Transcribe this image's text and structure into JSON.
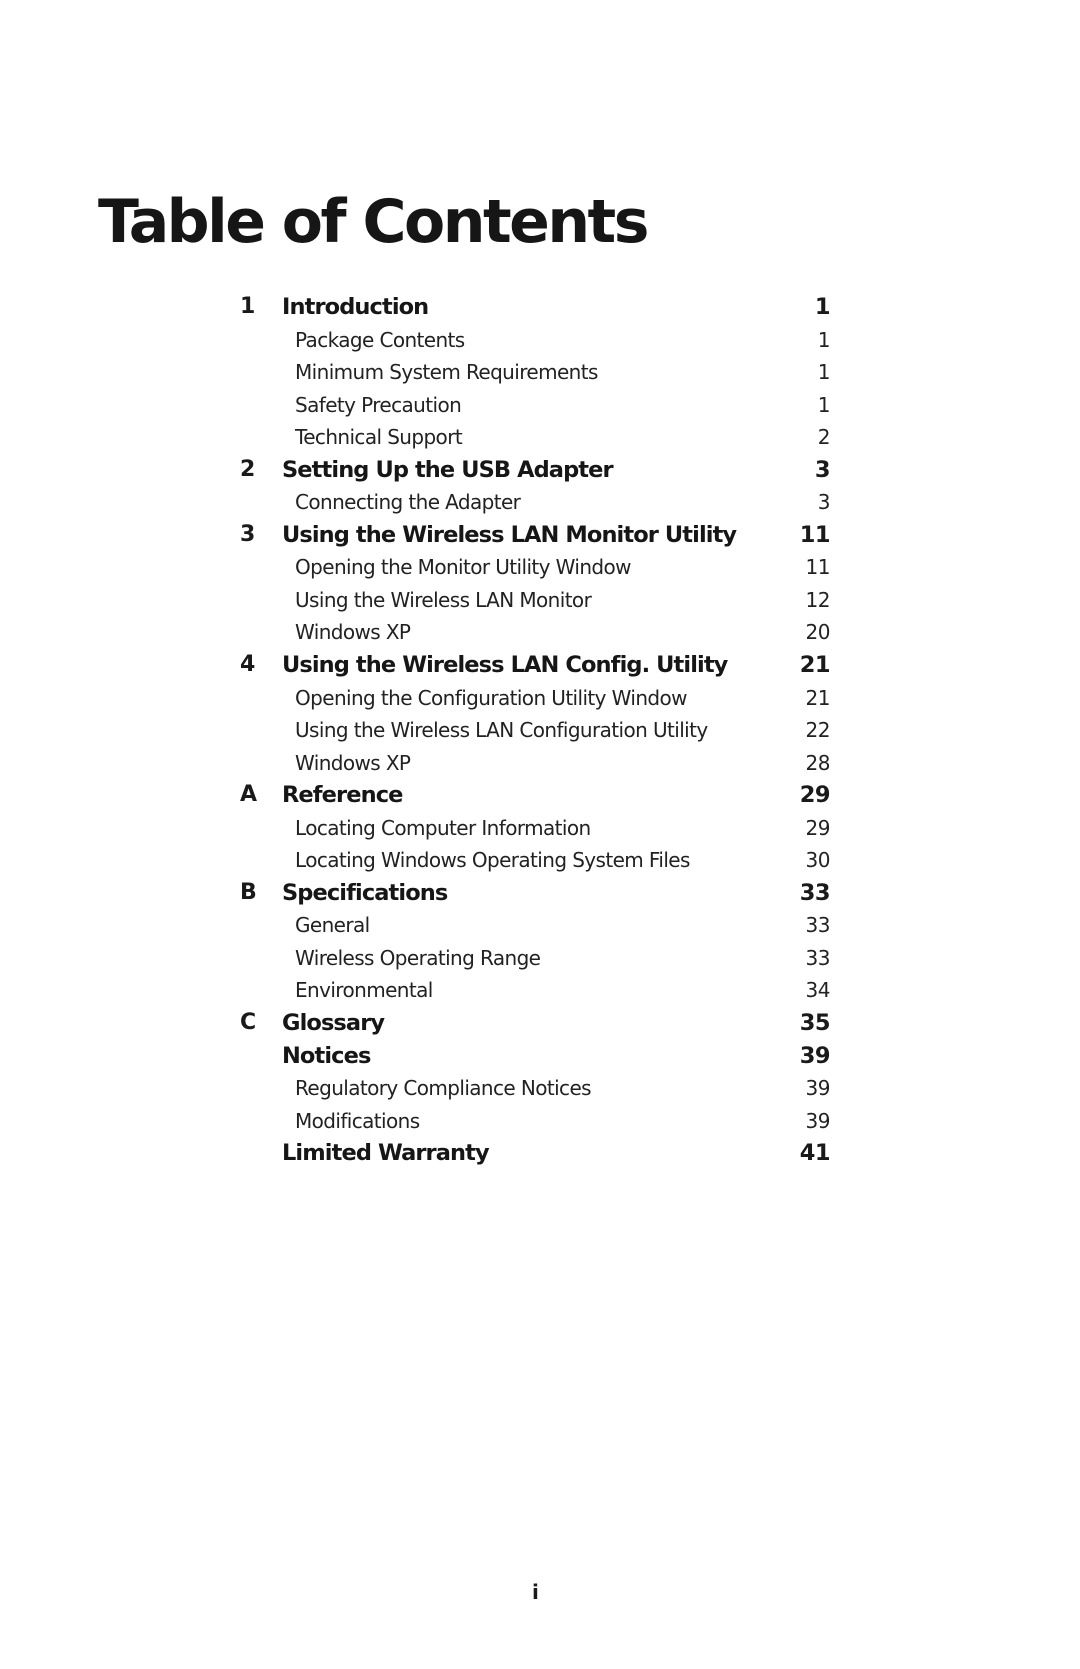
{
  "title": "Table of Contents",
  "entries": [
    {
      "level": "chapter",
      "number": "1",
      "label": "Introduction",
      "page": "1"
    },
    {
      "level": "sub",
      "number": "",
      "label": "Package Contents",
      "page": "1"
    },
    {
      "level": "sub",
      "number": "",
      "label": "Minimum System Requirements",
      "page": "1"
    },
    {
      "level": "sub",
      "number": "",
      "label": "Safety Precaution",
      "page": "1"
    },
    {
      "level": "sub",
      "number": "",
      "label": "Technical Support",
      "page": "2"
    },
    {
      "level": "chapter",
      "number": "2",
      "label": "Setting Up the USB Adapter",
      "page": "3"
    },
    {
      "level": "sub",
      "number": "",
      "label": "Connecting the Adapter",
      "page": "3"
    },
    {
      "level": "chapter",
      "number": "3",
      "label": "Using the Wireless LAN Monitor Utility",
      "page": "11"
    },
    {
      "level": "sub",
      "number": "",
      "label": "Opening the Monitor Utility Window",
      "page": "11"
    },
    {
      "level": "sub",
      "number": "",
      "label": "Using the Wireless LAN Monitor",
      "page": "12"
    },
    {
      "level": "sub",
      "number": "",
      "label": "Windows XP",
      "page": "20"
    },
    {
      "level": "chapter",
      "number": "4",
      "label": "Using the Wireless LAN Config.  Utility",
      "page": "21"
    },
    {
      "level": "sub",
      "number": "",
      "label": "Opening the Configuration Utility Window",
      "page": "21"
    },
    {
      "level": "sub",
      "number": "",
      "label": "Using the Wireless LAN Configuration Utility",
      "page": "22"
    },
    {
      "level": "sub",
      "number": "",
      "label": "Windows XP",
      "page": "28"
    },
    {
      "level": "chapter",
      "number": "A",
      "label": "Reference",
      "page": "29"
    },
    {
      "level": "sub",
      "number": "",
      "label": "Locating Computer Information",
      "page": "29"
    },
    {
      "level": "sub",
      "number": "",
      "label": "Locating Windows Operating System Files",
      "page": "30"
    },
    {
      "level": "chapter",
      "number": "B",
      "label": "Specifications",
      "page": "33"
    },
    {
      "level": "sub",
      "number": "",
      "label": "General",
      "page": "33"
    },
    {
      "level": "sub",
      "number": "",
      "label": "Wireless Operating Range",
      "page": "33"
    },
    {
      "level": "sub",
      "number": "",
      "label": "Environmental",
      "page": "34"
    },
    {
      "level": "chapter",
      "number": "C",
      "label": "Glossary",
      "page": "35"
    },
    {
      "level": "chapter",
      "number": "",
      "label": "Notices",
      "page": "39"
    },
    {
      "level": "sub",
      "number": "",
      "label": "Regulatory Compliance Notices",
      "page": "39"
    },
    {
      "level": "sub",
      "number": "",
      "label": "Modifications",
      "page": "39"
    },
    {
      "level": "chapter",
      "number": "",
      "label": "Limited Warranty",
      "page": "41"
    }
  ],
  "folio": "i"
}
